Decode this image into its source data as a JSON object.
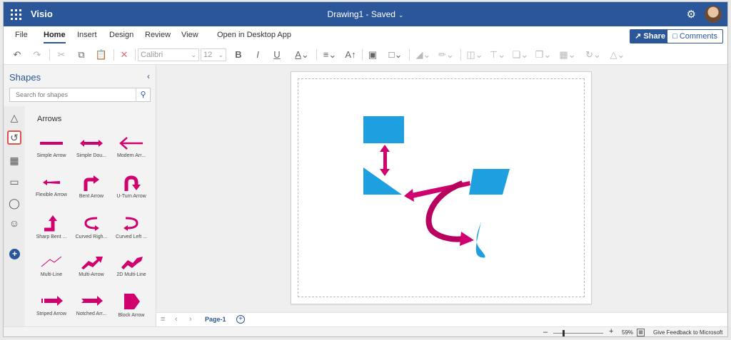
{
  "header": {
    "app_name": "Visio",
    "doc_title": "Drawing1 - Saved",
    "settings_icon": "gear-icon",
    "avatar_icon": "user-avatar"
  },
  "ribbon": {
    "tabs": [
      {
        "label": "File",
        "active": false
      },
      {
        "label": "Home",
        "active": true
      },
      {
        "label": "Insert",
        "active": false
      },
      {
        "label": "Design",
        "active": false
      },
      {
        "label": "Review",
        "active": false
      },
      {
        "label": "View",
        "active": false
      },
      {
        "label": "Open in Desktop App",
        "active": false
      }
    ],
    "share_label": "Share",
    "comments_label": "Comments"
  },
  "toolbar": {
    "font_name": "Calibri",
    "font_size": "12",
    "bold": "B",
    "italic": "I",
    "underline": "U"
  },
  "shapes_panel": {
    "title": "Shapes",
    "search_placeholder": "Search for shapes",
    "stencil_title": "Arrows",
    "items": [
      {
        "label": "Simple Arrow",
        "icon": "simple-arrow-icon"
      },
      {
        "label": "Simple Dou...",
        "icon": "double-arrow-icon"
      },
      {
        "label": "Modern Arr...",
        "icon": "modern-arrow-icon"
      },
      {
        "label": "Flexible Arrow",
        "icon": "flexible-arrow-icon"
      },
      {
        "label": "Bent Arrow",
        "icon": "bent-arrow-icon"
      },
      {
        "label": "U-Turn Arrow",
        "icon": "u-turn-arrow-icon"
      },
      {
        "label": "Sharp Bent ...",
        "icon": "sharp-bent-arrow-icon"
      },
      {
        "label": "Curved Righ...",
        "icon": "curved-right-arrow-icon"
      },
      {
        "label": "Curved Left ...",
        "icon": "curved-left-arrow-icon"
      },
      {
        "label": "Multi-Line",
        "icon": "multi-line-icon"
      },
      {
        "label": "Multi-Arrow",
        "icon": "multi-arrow-icon"
      },
      {
        "label": "2D Multi-Line",
        "icon": "2d-multi-line-icon"
      },
      {
        "label": "Striped Arrow",
        "icon": "striped-arrow-icon"
      },
      {
        "label": "Notched Arr...",
        "icon": "notched-arrow-icon"
      },
      {
        "label": "Block Arrow",
        "icon": "block-arrow-icon"
      }
    ]
  },
  "canvas": {
    "shape_color": "#1e9fe0",
    "arrow_color": "#d0006f"
  },
  "page_tabs": {
    "current": "Page-1"
  },
  "status": {
    "zoom": "59%",
    "feedback": "Give Feedback to Microsoft"
  },
  "colors": {
    "accent": "#2b579a",
    "arrow_pink": "#d0006f",
    "shape_blue": "#1e9fe0"
  }
}
